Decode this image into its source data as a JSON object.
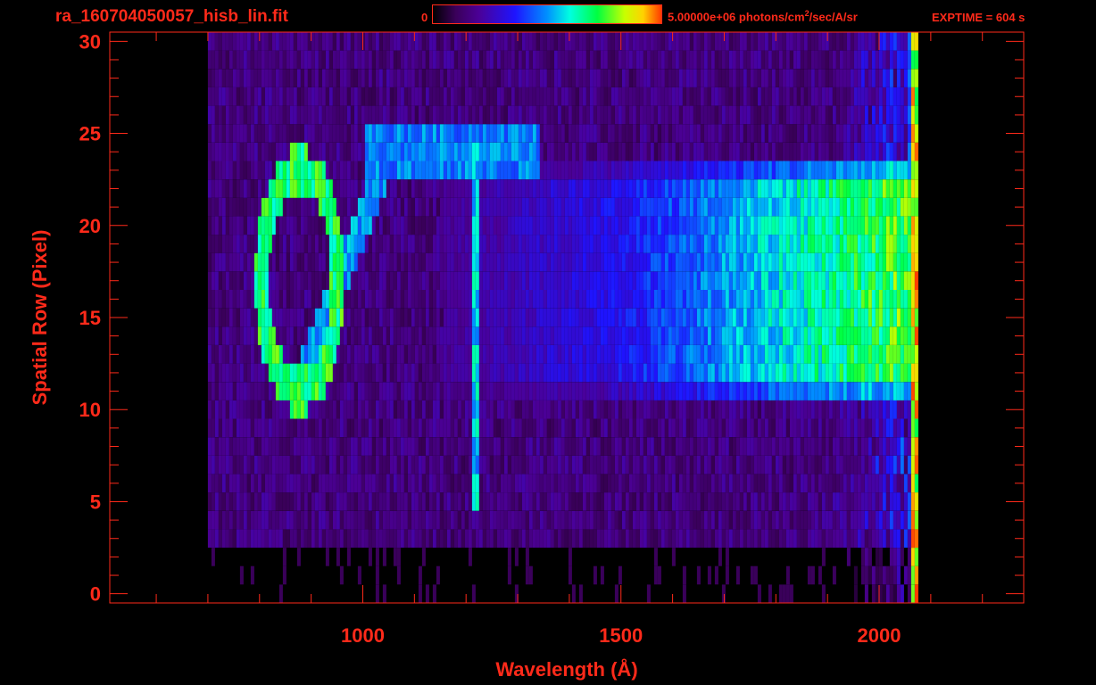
{
  "file_title": "ra_160704050057_hisb_lin.fit",
  "colorbar": {
    "min_label": "0",
    "max_label_main": "5.00000e+06 photons/cm",
    "max_label_sup": "2",
    "max_label_tail": "/sec/A/sr",
    "colormap": "rainbow",
    "min_value": 0,
    "max_value": 5000000
  },
  "exptime_label": "EXPTIME = 604 s",
  "colors": {
    "axis": "#ff2a1a",
    "background": "#000000"
  },
  "chart_data": {
    "type": "heatmap",
    "xlabel": "Wavelength (Å)",
    "ylabel": "Spatial Row (Pixel)",
    "xlim": [
      510,
      2280
    ],
    "ylim": [
      -0.5,
      30.5
    ],
    "xticks": [
      1000,
      1500,
      2000
    ],
    "xtick_labels": [
      "1000",
      "1500",
      "2000"
    ],
    "yticks": [
      0,
      5,
      10,
      15,
      20,
      25,
      30
    ],
    "ytick_labels": [
      "0",
      "5",
      "10",
      "15",
      "20",
      "25",
      "30"
    ],
    "grid": false,
    "legend": "colorbar top",
    "data_extent": {
      "x_range": [
        700,
        2075
      ],
      "row_range": [
        0,
        30
      ]
    },
    "features": [
      {
        "name": "ring-shaped emission (left)",
        "x_range": [
          790,
          960
        ],
        "rows": [
          10,
          24
        ],
        "approx_level": 0.7
      },
      {
        "name": "diagonal emission streak",
        "x_range": [
          870,
          1020
        ],
        "rows": [
          11,
          22
        ],
        "approx_level": 0.5
      },
      {
        "name": "vertical line",
        "x": 1215,
        "rows": [
          5,
          24
        ],
        "approx_level": 0.55
      },
      {
        "name": "top emission band",
        "x_range": [
          1000,
          1340
        ],
        "rows": [
          23,
          25
        ],
        "approx_level": 0.5
      },
      {
        "name": "bright continuum band",
        "x_range": [
          1150,
          2070
        ],
        "rows": [
          11,
          23
        ],
        "approx_level_at_x": [
          [
            1150,
            0.2
          ],
          [
            1500,
            0.35
          ],
          [
            1800,
            0.6
          ],
          [
            2070,
            0.78
          ]
        ]
      },
      {
        "name": "edge column",
        "x": 2068,
        "rows": [
          0,
          30
        ],
        "approx_level": 0.9
      }
    ]
  }
}
